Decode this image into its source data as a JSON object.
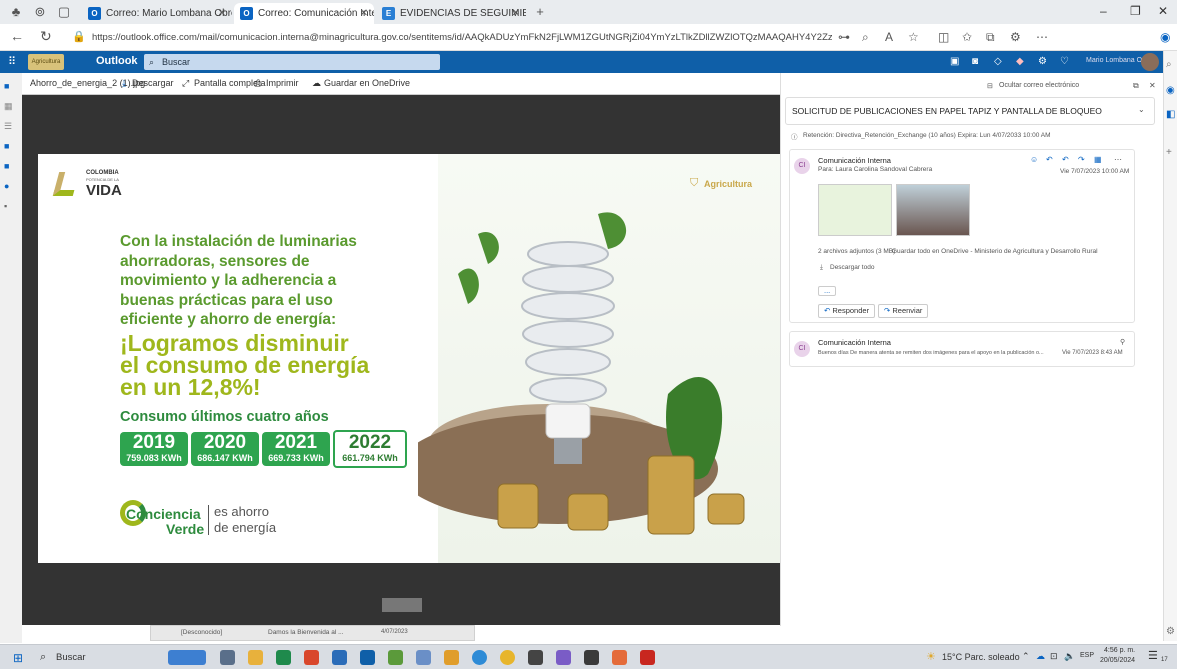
{
  "browser": {
    "tabs": [
      {
        "label": "Correo: Mario Lombana Obregó",
        "active": false
      },
      {
        "label": "Correo: Comunicación Interna - ",
        "active": true
      },
      {
        "label": "EVIDENCIAS DE SEGUIMIENTO D",
        "active": false
      }
    ],
    "url": "https://outlook.office.com/mail/comunicacion.interna@minagricultura.gov.co/sentitems/id/AAQkADUzYmFkN2FjLWM1ZGUtNGRjZi04YmYzLTlkZDllZWZlOTQzMAAQAHY4Y2Zz0E9BmVPSoNdG1jM%3D/sxs/AAMkADU..."
  },
  "outlook": {
    "org_label": "Agricultura",
    "app_name": "Outlook",
    "search_placeholder": "Buscar",
    "user_name": "Mario Lombana O..."
  },
  "viewer": {
    "file_name": "Ahorro_de_energia_2 (1).jpg",
    "download": "Descargar",
    "fullscreen": "Pantalla completa",
    "print": "Imprimir",
    "save_onedrive": "Guardar en OneDrive"
  },
  "poster": {
    "brand_top": "COLOMBIA",
    "brand_mid": "POTENCIA DE LA",
    "brand_main": "VIDA",
    "agri": "Agricultura",
    "intro_lines": [
      "Con la instalación de luminarias",
      "ahorradoras, sensores de",
      "movimiento y la adherencia a",
      "buenas prácticas para el uso",
      "eficiente y ahorro de energía:"
    ],
    "headline_lines": [
      "¡Logramos disminuir",
      "el consumo de energía",
      "en un 12,8%!"
    ],
    "sub": "Consumo últimos cuatro años",
    "years": [
      {
        "year": "2019",
        "kwh": "759.083 KWh"
      },
      {
        "year": "2020",
        "kwh": "686.147 KWh"
      },
      {
        "year": "2021",
        "kwh": "669.733 KWh"
      },
      {
        "year": "2022",
        "kwh": "661.794 KWh"
      }
    ],
    "logo_word1": "Conciencia",
    "logo_word2": "Verde",
    "tag1": "es ahorro",
    "tag2": "de energía"
  },
  "reading": {
    "hide_email": "Ocultar correo electrónico",
    "subject": "SOLICITUD DE PUBLICACIONES EN PAPEL TAPIZ Y PANTALLA DE BLOQUEO",
    "retention": "Retención: Directiva_Retención_Exchange (10 años) Expira: Lun 4/07/2033 10:00 AM",
    "msg1": {
      "sender": "Comunicación Interna",
      "to": "Para:  Laura Carolina Sandoval Cabrera",
      "date": "Vie 7/07/2023 10:00 AM",
      "attach_info": "2 archivos adjuntos (3 MB)",
      "save_all": "Guardar todo en OneDrive - Ministerio de Agricultura y Desarrollo Rural",
      "download_all": "Descargar todo",
      "more": "...",
      "reply": "Responder",
      "forward": "Reenviar"
    },
    "msg2": {
      "sender": "Comunicación Interna",
      "preview": "Buenos días De manera atenta se remiten dos imágenes para el apoyo en la publicación o...",
      "date": "Vie 7/07/2023 8:43 AM"
    }
  },
  "bottom_row": {
    "col1": "[Desconocido]",
    "col2": "Damos la Bienvenida al ...",
    "col3": "4/07/2023"
  },
  "taskbar": {
    "search": "Buscar",
    "weather": "15°C  Parc. soleado",
    "lang": "ESP",
    "time": "4:56 p. m.",
    "date": "20/05/2024",
    "notif": "17"
  },
  "colors": {
    "outlook_blue": "#0f5fa8",
    "poster_green": "#5a9a2e",
    "headline_yellow": "#9fb71c",
    "year_green": "#2ea44f"
  }
}
